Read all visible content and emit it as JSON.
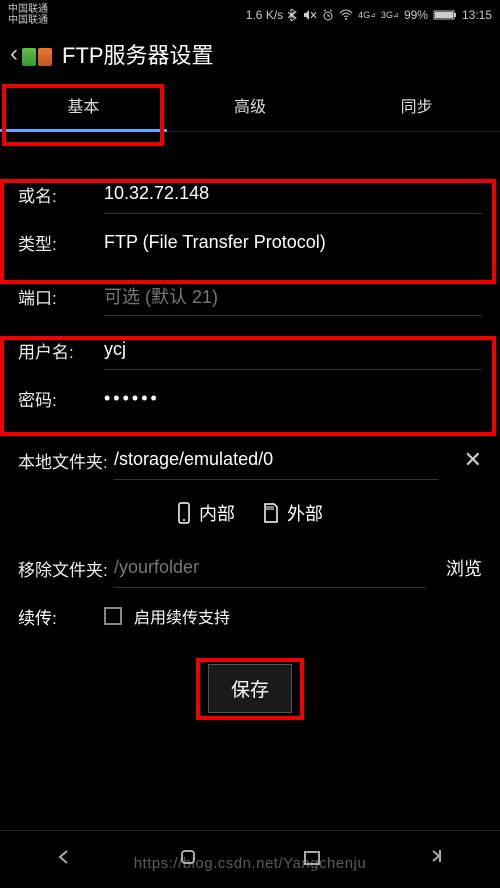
{
  "statusbar": {
    "carrier": "中国联通\n中国联通",
    "speed": "1.6 K/s",
    "battery": "99%",
    "time": "13:15"
  },
  "appbar": {
    "title": "FTP服务器设置"
  },
  "tabs": {
    "basic": "基本",
    "advanced": "高级",
    "sync": "同步"
  },
  "form": {
    "host_label": "或名:",
    "host_value": "10.32.72.148",
    "type_label": "类型:",
    "type_value": "FTP (File Transfer Protocol)",
    "port_label": "端口:",
    "port_placeholder": "可选 (默认 21)",
    "user_label": "用户名:",
    "user_value": "ycj",
    "pass_label": "密码:",
    "pass_value": "••••••",
    "localdir_label": "本地文件夹:",
    "localdir_value": "/storage/emulated/0",
    "storage_internal": "内部",
    "storage_external": "外部",
    "remove_label": "移除文件夹:",
    "remove_placeholder": "/yourfolder",
    "browse": "浏览",
    "resume_label": "续传:",
    "resume_text": "启用续传支持",
    "save": "保存"
  },
  "watermark": "https://blog.csdn.net/Yangchenju"
}
